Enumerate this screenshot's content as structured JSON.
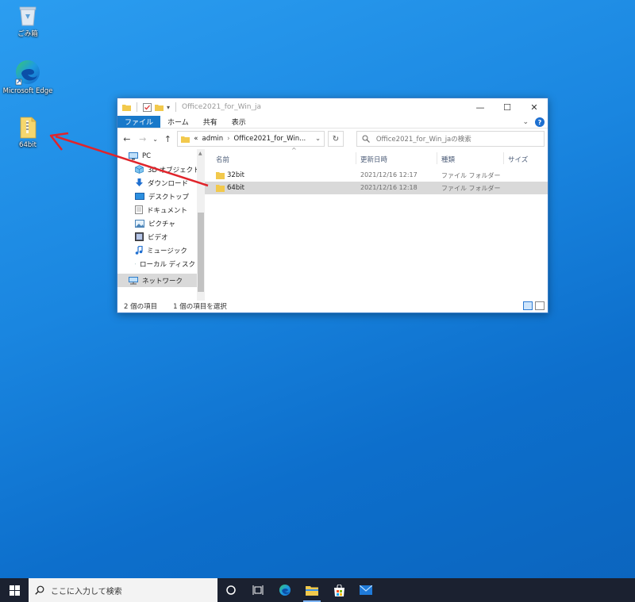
{
  "desktop": {
    "icons": [
      {
        "label": "ごみ箱"
      },
      {
        "label": "Microsoft Edge"
      },
      {
        "label": "64bit"
      }
    ]
  },
  "explorer": {
    "title": "Office2021_for_Win_ja",
    "window_controls": {
      "minimize": "—",
      "maximize": "☐",
      "close": "✕"
    },
    "ribbon_tabs": [
      "ファイル",
      "ホーム",
      "共有",
      "表示"
    ],
    "address": {
      "prefix": "«",
      "crumbs": [
        "admin",
        "Office2021_for_Win..."
      ]
    },
    "search_placeholder": "Office2021_for_Win_jaの検索",
    "nav_items": [
      {
        "label": "PC"
      },
      {
        "label": "3D オブジェクト"
      },
      {
        "label": "ダウンロード"
      },
      {
        "label": "デスクトップ"
      },
      {
        "label": "ドキュメント"
      },
      {
        "label": "ピクチャ"
      },
      {
        "label": "ビデオ"
      },
      {
        "label": "ミュージック"
      },
      {
        "label": "ローカル ディスク (C"
      },
      {
        "label": "ネットワーク"
      }
    ],
    "columns": [
      "名前",
      "更新日時",
      "種類",
      "サイズ"
    ],
    "files": [
      {
        "name": "32bit",
        "modified": "2021/12/16 12:17",
        "type": "ファイル フォルダー"
      },
      {
        "name": "64bit",
        "modified": "2021/12/16 12:18",
        "type": "ファイル フォルダー"
      }
    ],
    "status": {
      "count": "2 個の項目",
      "selected": "1 個の項目を選択"
    }
  },
  "taskbar": {
    "search_placeholder": "ここに入力して検索"
  },
  "colors": {
    "accent": "#1979ca",
    "arrow": "#e0242b",
    "taskbar": "#1b2130"
  }
}
